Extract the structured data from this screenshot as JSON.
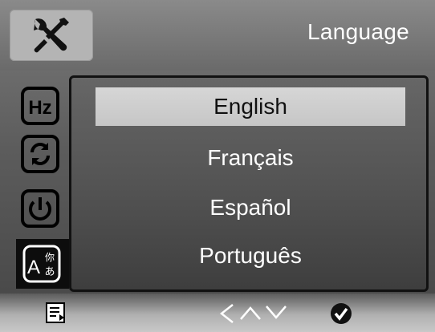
{
  "header": {
    "tab_icon": "tools-icon",
    "title": "Language"
  },
  "sidebar": {
    "items": [
      {
        "icon": "frequency-hz-icon",
        "active": false
      },
      {
        "icon": "rotate-icon",
        "active": false
      },
      {
        "icon": "power-icon",
        "active": false
      },
      {
        "icon": "language-icon",
        "active": true
      }
    ]
  },
  "language_list": {
    "items": [
      {
        "label": "English",
        "selected": true
      },
      {
        "label": "Français",
        "selected": false
      },
      {
        "label": "Español",
        "selected": false
      },
      {
        "label": "Português",
        "selected": false
      }
    ]
  },
  "footer": {
    "menu_icon": "menu-icon",
    "nav_icons": [
      "left-chevron-icon",
      "up-chevron-icon",
      "down-chevron-icon"
    ],
    "confirm_icon": "confirm-check-icon"
  },
  "colors": {
    "selection_bar": "#cfcfcf",
    "active_icon_background": "#0d0d0d",
    "text": "#ffffff"
  }
}
